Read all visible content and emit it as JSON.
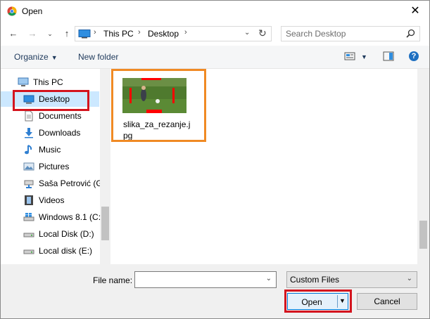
{
  "window": {
    "title": "Open",
    "close_symbol": "✕"
  },
  "nav": {
    "breadcrumb": [
      "This PC",
      "Desktop"
    ],
    "search_placeholder": "Search Desktop"
  },
  "toolbar": {
    "organize_label": "Organize",
    "new_folder_label": "New folder"
  },
  "sidebar": {
    "items": [
      {
        "label": "This PC",
        "icon": "computer-icon"
      },
      {
        "label": "Desktop",
        "icon": "desktop-icon"
      },
      {
        "label": "Documents",
        "icon": "documents-icon"
      },
      {
        "label": "Downloads",
        "icon": "downloads-icon"
      },
      {
        "label": "Music",
        "icon": "music-icon"
      },
      {
        "label": "Pictures",
        "icon": "pictures-icon"
      },
      {
        "label": "Saša Petrović (G:",
        "icon": "network-drive-icon"
      },
      {
        "label": "Videos",
        "icon": "videos-icon"
      },
      {
        "label": "Windows 8.1 (C:",
        "icon": "windows-drive-icon"
      },
      {
        "label": "Local Disk (D:)",
        "icon": "drive-icon"
      },
      {
        "label": "Local disk (E:)",
        "icon": "drive-icon"
      }
    ],
    "selected": "Desktop"
  },
  "files": [
    {
      "name": "slika_za_rezanje.jpg",
      "type": "image"
    }
  ],
  "bottom": {
    "file_name_label": "File name:",
    "file_name_value": "",
    "file_type_value": "Custom Files",
    "open_label": "Open",
    "cancel_label": "Cancel"
  },
  "colors": {
    "selection": "#cce8ff",
    "highlight_orange": "#f08a24",
    "highlight_red": "#d4141e",
    "accent_blue": "#0078d7"
  }
}
